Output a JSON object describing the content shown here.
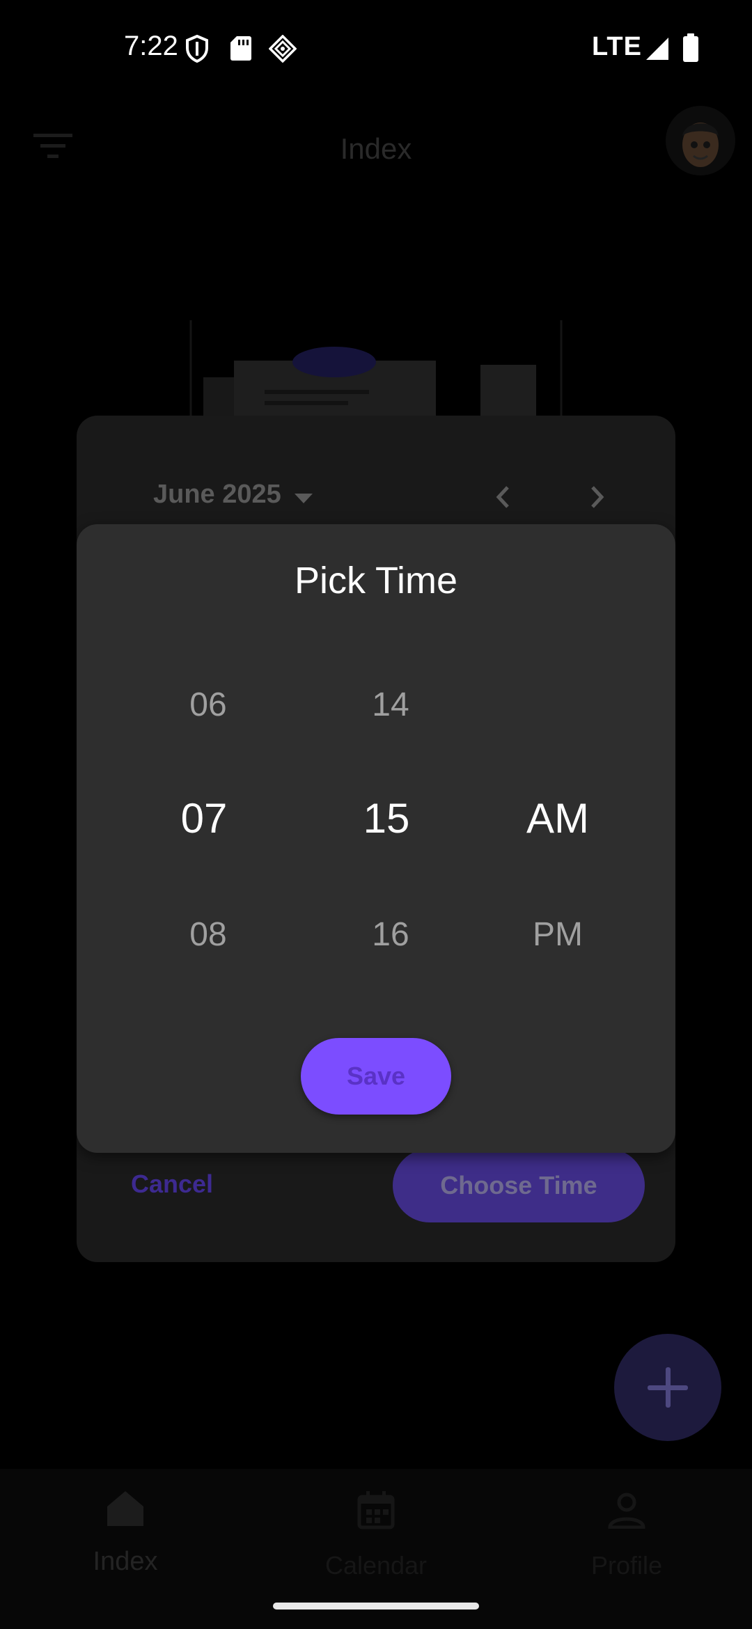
{
  "status_bar": {
    "time": "7:22",
    "network": "LTE",
    "icons": [
      "shield-icon",
      "sd-card-icon",
      "sync-diamond-icon",
      "signal-icon",
      "battery-icon"
    ]
  },
  "app_bar": {
    "title": "Index",
    "icons": [
      "filter-icon",
      "avatar"
    ]
  },
  "date_picker": {
    "month_label": "June 2025",
    "cancel_label": "Cancel",
    "choose_time_label": "Choose Time"
  },
  "time_picker": {
    "title": "Pick Time",
    "hours": {
      "prev": "06",
      "selected": "07",
      "next": "08"
    },
    "minutes": {
      "prev": "14",
      "selected": "15",
      "next": "16"
    },
    "period": {
      "selected": "AM",
      "next": "PM"
    },
    "save_label": "Save"
  },
  "bottom_nav": {
    "items": [
      {
        "label": "Index",
        "icon": "home-icon",
        "active": true
      },
      {
        "label": "Calendar",
        "icon": "calendar-icon",
        "active": false
      },
      {
        "label": "Profile",
        "icon": "person-icon",
        "active": false
      }
    ]
  },
  "colors": {
    "accent": "#7c4dff",
    "scrim_surface": "#191919",
    "dialog_surface": "#2e2e2e"
  }
}
